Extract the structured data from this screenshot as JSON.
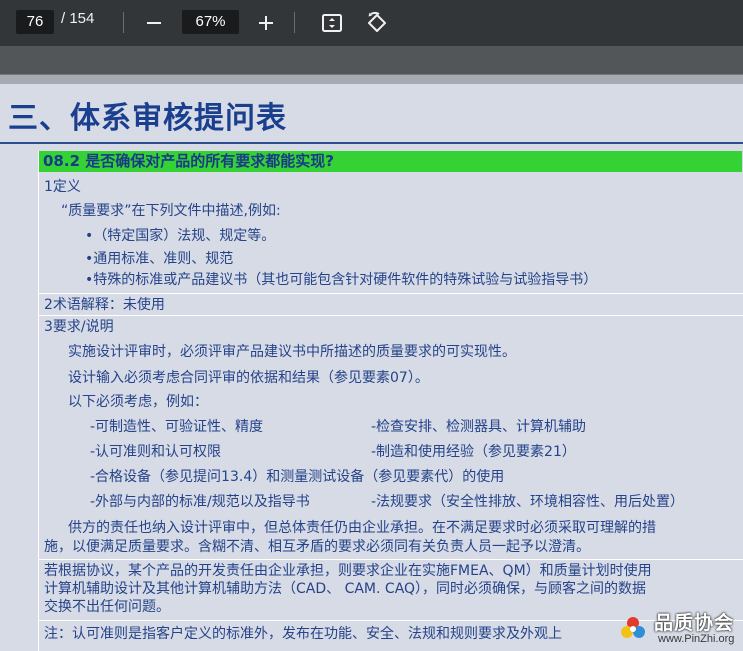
{
  "toolbar": {
    "current_page": "76",
    "page_total": "/ 154",
    "zoom_out_icon": "minus-icon",
    "zoom_level": "67%",
    "zoom_in_icon": "plus-icon",
    "fit_icon": "fit-to-page-icon",
    "rotate_icon": "rotate-icon"
  },
  "slide": {
    "title": "三、体系审核提问表",
    "question": "08.2 是否确保对产品的所有要求都能实现?",
    "definition_heading": "1定义",
    "definition_intro": "“质量要求”在下列文件中描述,例如:",
    "definition_items": [
      "•（特定国家）法规、规定等。",
      "•通用标准、准则、规范",
      "•特殊的标准或产品建议书（其也可能包含针对硬件软件的特殊试验与试验指导书）"
    ],
    "term_row": "2术语解释：未使用",
    "requirement_heading": "3要求/说明",
    "req_lines": [
      "实施设计评审时，必须评审产品建议书中所描述的质量要求的可实现性。",
      "设计输入必须考虑合同评审的依据和结果（参见要素07）。",
      "以下必须考虑，例如："
    ],
    "consider_left": [
      "-可制造性、可验证性、精度",
      "-认可准则和认可权限",
      "-合格设备（参见提问13.4）和测量测试设备（参见要素代）的使用",
      "-外部与内部的标准/规范以及指导书"
    ],
    "consider_right": [
      "-检查安排、检测器具、计算机辅助",
      "-制造和使用经验（参见要素21）",
      "",
      "-法规要求（安全性排放、环境相容性、用后处置）"
    ],
    "para1": [
      "供方的责任也纳入设计评审中，但总体责任仍由企业承担。在不满足要求时必须采取可理解的措",
      "施，以便满足质量要求。含糊不清、相互矛盾的要求必须同有关负责人员一起予以澄清。"
    ],
    "para2": [
      "若根据协议，某个产品的开发责任由企业承担，则要求企业在实施FMEA、QM）和质量计划时使用",
      "计算机辅助设计及其他计算机辅助方法（CAD、 CAM. CAQ），同时必须确保，与顾客之间的数据",
      "交换不出任何问题。"
    ],
    "note": "注：认可准则是指客户定义的标准外，发布在功能、安全、法规和规则要求及外观上"
  },
  "watermark": {
    "name": "品质协会",
    "url": "www.PinZhi.org"
  },
  "colors": {
    "toolbar_bg": "#323639",
    "viewer_bg": "#525659",
    "slide_bg": "#d6dbe5",
    "title_blue": "#1b3f8f",
    "text_blue": "#26438a",
    "header_green": "#35d235"
  }
}
